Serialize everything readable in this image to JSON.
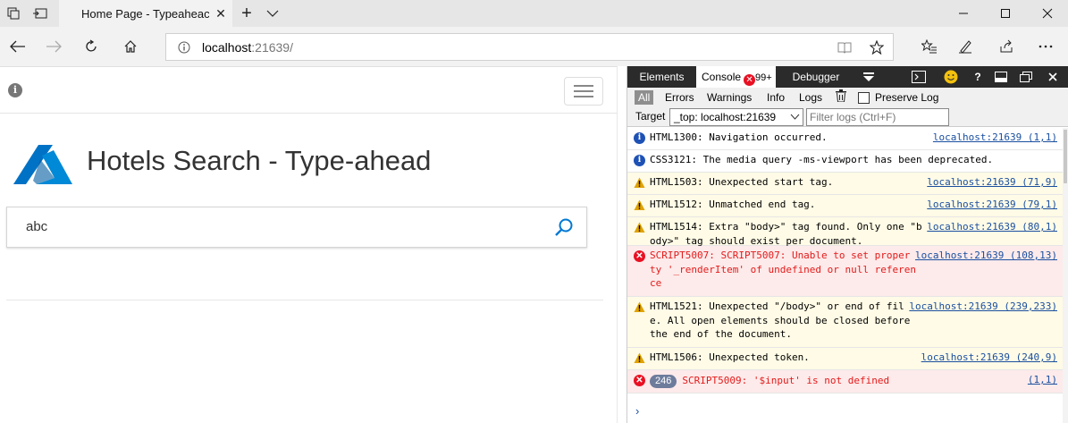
{
  "browser": {
    "tab_title": "Home Page - Typeaheac",
    "address": {
      "host": "localhost",
      "port": ":21639/"
    },
    "icons": [
      "tab-preview-icon",
      "set-aside-icon",
      "close-icon",
      "new-tab-icon",
      "tab-list-icon",
      "minimize-icon",
      "maximize-icon",
      "window-close-icon",
      "back-icon",
      "forward-icon",
      "refresh-icon",
      "home-icon",
      "site-info-icon",
      "reading-view-icon",
      "favorite-star-icon",
      "favorites-hub-icon",
      "pen-icon",
      "share-icon",
      "more-icon"
    ]
  },
  "page": {
    "title": "Hotels Search - Type-ahead",
    "search_value": "abc",
    "accent_color": "#0078d4"
  },
  "devtools": {
    "tabs": {
      "elements": "Elements",
      "console": "Console",
      "console_badge": "99+",
      "debugger": "Debugger"
    },
    "filters": {
      "all": "All",
      "errors": "Errors",
      "warnings": "Warnings",
      "info": "Info",
      "logs": "Logs",
      "preserve": "Preserve Log"
    },
    "target": {
      "label": "Target",
      "value": "_top: localhost:21639",
      "filter_placeholder": "Filter logs (Ctrl+F)"
    },
    "messages": [
      {
        "level": "info",
        "text": "HTML1300: Navigation occurred.",
        "source": "localhost:21639 (1,1)"
      },
      {
        "level": "info",
        "text": "CSS3121: The media query -ms-viewport has been deprecated.",
        "source": ""
      },
      {
        "level": "warn",
        "text": "HTML1503: Unexpected start tag.",
        "source": "localhost:21639 (71,9)"
      },
      {
        "level": "warn",
        "text": "HTML1512: Unmatched end tag.",
        "source": "localhost:21639 (79,1)"
      },
      {
        "level": "warn",
        "text": "HTML1514: Extra \"body>\" tag found. Only one \"b\nody>\" tag should exist per document.",
        "source": "localhost:21639 (80,1)"
      },
      {
        "level": "error",
        "text": "SCRIPT5007: SCRIPT5007: Unable to set proper\nty '_renderItem' of undefined or null referen\nce",
        "source": "localhost:21639 (108,13)"
      },
      {
        "level": "warn",
        "text": "HTML1521: Unexpected \"/body>\" or end of fil\ne. All open elements should be closed before\nthe end of the document.",
        "source": "localhost:21639 (239,233)"
      },
      {
        "level": "warn",
        "text": "HTML1506: Unexpected token.",
        "source": "localhost:21639 (240,9)"
      },
      {
        "level": "error",
        "count": "246",
        "text": "SCRIPT5009: '$input' is not defined",
        "source": "(1,1)"
      }
    ],
    "prompt": "›"
  }
}
